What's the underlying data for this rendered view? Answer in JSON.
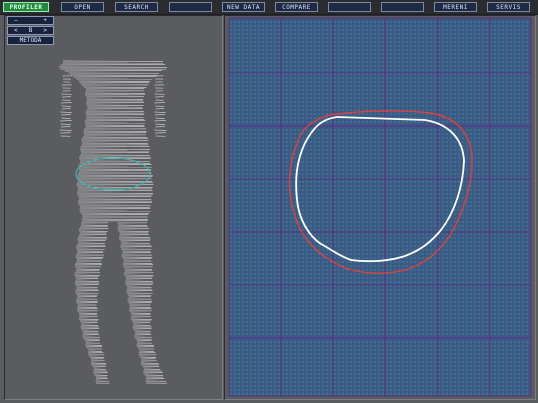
{
  "menu": {
    "profiler": "PROFILER",
    "open": "OPEN",
    "search": "SEARCH",
    "new_data": "NEW DATA",
    "compare": "COMPARE",
    "mereni": "MERENI",
    "servis": "SERVIS"
  },
  "tools": {
    "minus": "—",
    "plus": "+",
    "prev": "<",
    "value": "B",
    "next": ">",
    "metoda": "METODA"
  },
  "colors": {
    "body_mesh": "#d9d9d9",
    "section_ring": "#3fb0b4",
    "grid_background": "#3c5a86",
    "grid_dots": "#43b4a8",
    "grid_major": "#5a2c80",
    "outer_contour": "#e0403a",
    "inner_contour": "#ffffff"
  }
}
